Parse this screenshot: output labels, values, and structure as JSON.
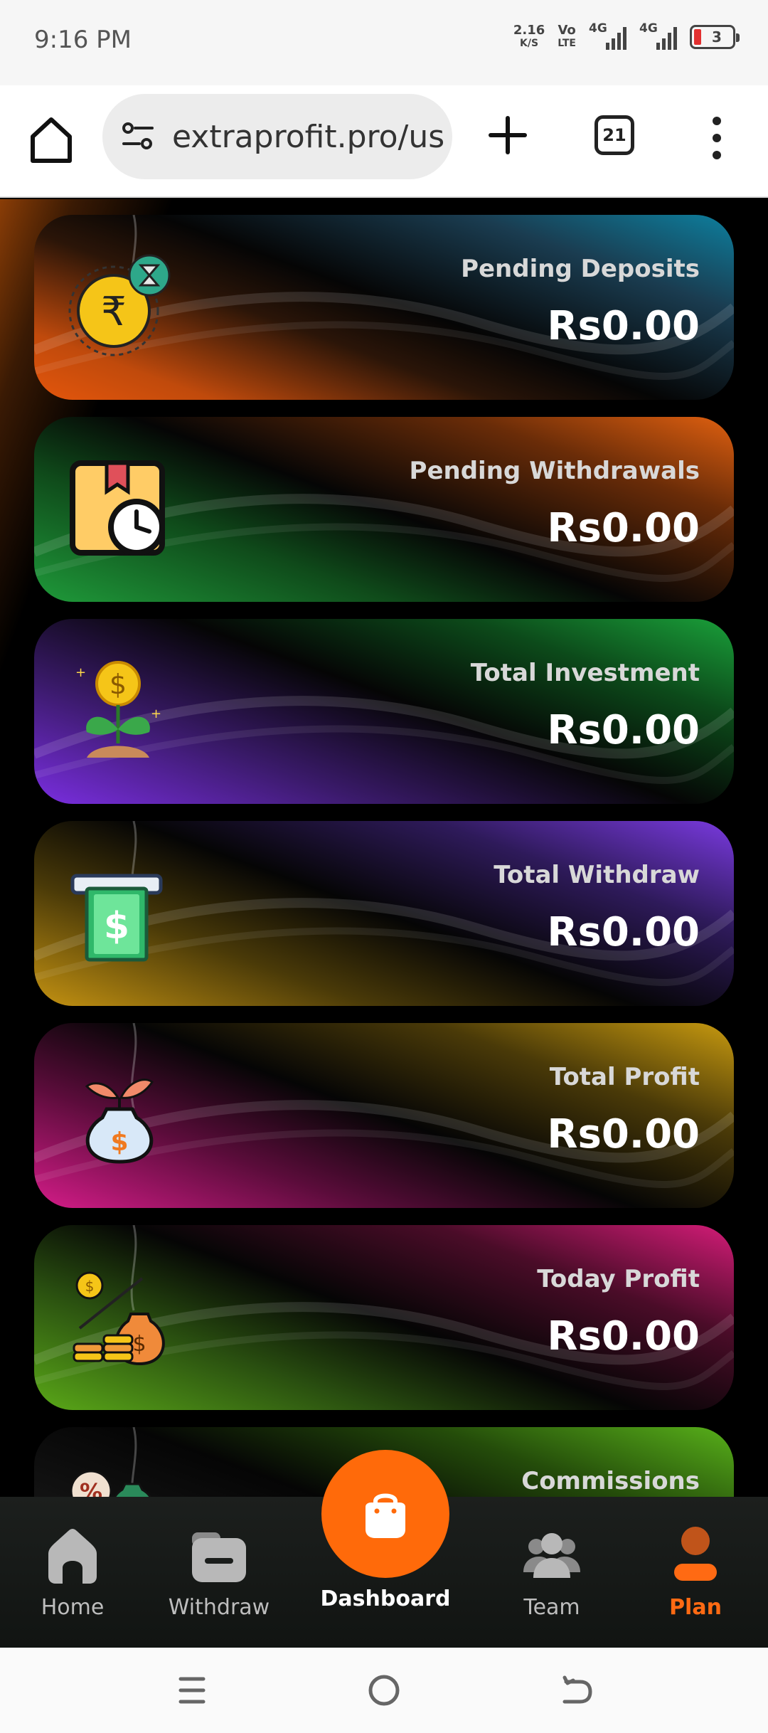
{
  "status_bar": {
    "time": "9:16 PM",
    "net_speed": "2.16",
    "net_unit": "K/S",
    "volte_top": "Vo",
    "volte_bottom": "LTE",
    "sim1": "4G",
    "sim2": "4G",
    "battery": "3"
  },
  "browser": {
    "url": "extraprofit.pro/us",
    "tab_count": "21"
  },
  "cards": [
    {
      "label": "Pending Deposits",
      "value": "Rs0.00",
      "icon": "rupee-pending-icon"
    },
    {
      "label": "Pending Withdrawals",
      "value": "Rs0.00",
      "icon": "package-clock-icon"
    },
    {
      "label": "Total Investment",
      "value": "Rs0.00",
      "icon": "coin-plant-icon"
    },
    {
      "label": "Total Withdraw",
      "value": "Rs0.00",
      "icon": "atm-cash-icon"
    },
    {
      "label": "Total Profit",
      "value": "Rs0.00",
      "icon": "money-bag-sprout-icon"
    },
    {
      "label": "Today Profit",
      "value": "Rs0.00",
      "icon": "coins-moneybag-icon"
    },
    {
      "label": "Commissions",
      "value": "",
      "icon": "percent-bag-icon"
    }
  ],
  "bottom_nav": {
    "home": "Home",
    "withdraw": "Withdraw",
    "dashboard": "Dashboard",
    "team": "Team",
    "plan": "Plan"
  },
  "colors": {
    "accent": "#ff6a0a",
    "plan_active": "#ff6a13"
  }
}
